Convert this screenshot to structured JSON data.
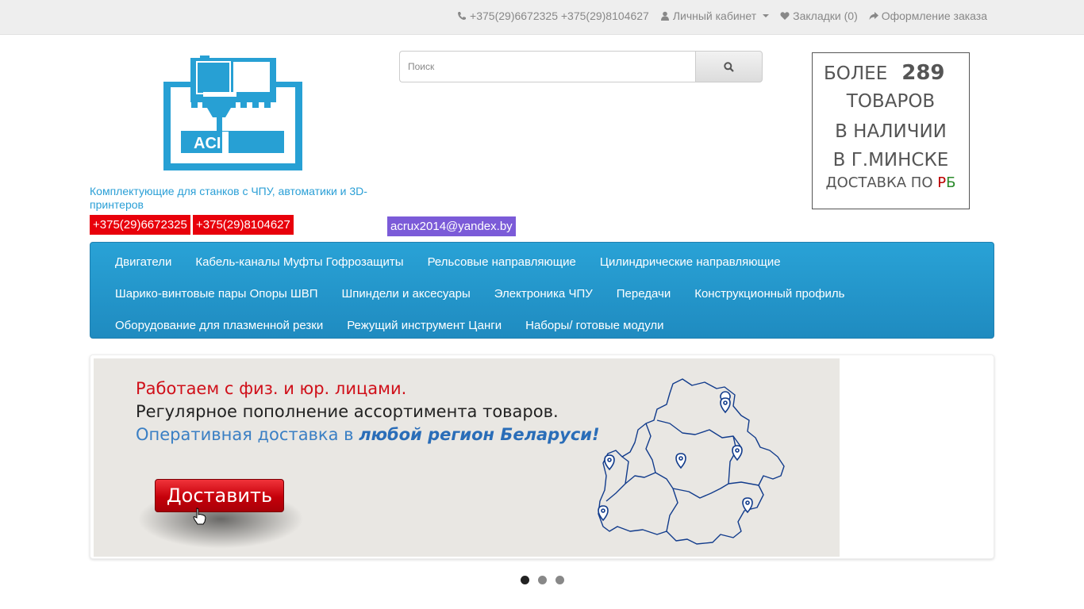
{
  "topbar": {
    "phones": "+375(29)6672325 +375(29)8104627",
    "account": "Личный кабинет",
    "bookmarks": "Закладки (0)",
    "checkout": "Оформление заказа"
  },
  "logo": {
    "text": "ACI"
  },
  "tagline": "Комплектующие для станков с ЧПУ, автоматики и 3D-принтеров",
  "phone_badges": [
    "+375(29)6672325",
    "+375(29)8104627"
  ],
  "email": "acrux2014@yandex.by",
  "search": {
    "placeholder": "Поиск",
    "button_icon": "search-icon"
  },
  "promo": {
    "line1": "БОЛЕЕ",
    "count": "289",
    "line2": "ТОВАРОВ",
    "line3": "В НАЛИЧИИ",
    "line4": "В Г.МИНСКЕ",
    "line5": "ДОСТАВКА ПО ",
    "line5_r": "Р",
    "line5_b": "Б"
  },
  "nav": {
    "rows": [
      [
        "Двигатели",
        "Кабель-каналы Муфты Гофрозащиты",
        "Рельсовые направляющие",
        "Цилиндрические направляющие"
      ],
      [
        "Шарико-винтовые пары Опоры ШВП",
        "Шпиндели и аксесуары",
        "Электроника ЧПУ",
        "Передачи",
        "Конструкционный профиль"
      ],
      [
        "Оборудование для плазменной резки",
        "Режущий инструмент Цанги",
        "Наборы/ готовые модули"
      ]
    ]
  },
  "slide": {
    "line1": "Работаем с физ. и юр. лицами.",
    "line2": "Регулярное пополнение ассортимента товаров.",
    "line3_start": "Оперативная доставка в ",
    "line3_bold": "любой регион Беларуси!",
    "button": "Доставить"
  },
  "slider_dots": {
    "count": 3,
    "active": 0
  },
  "colors": {
    "accent": "#2a9fd6",
    "badge_red": "#e8000b",
    "badge_purple": "#7b5bd8",
    "nav": "#259ad0"
  }
}
